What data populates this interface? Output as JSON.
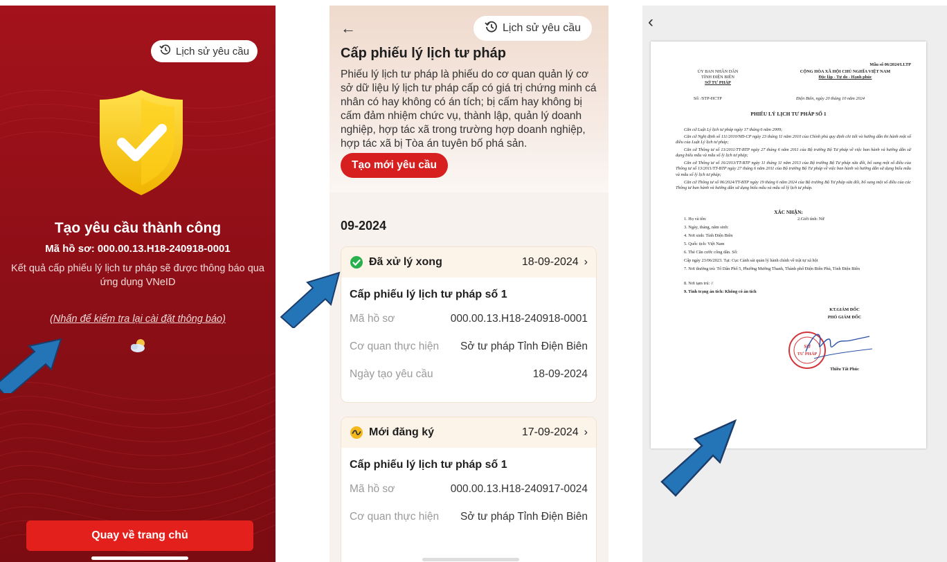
{
  "panel1": {
    "history_label": "Lịch sử yêu cầu",
    "title": "Tạo yêu cầu thành công",
    "code": "Mã hồ sơ: 000.00.13.H18-240918-0001",
    "description": "Kết quả cấp phiếu lý lịch tư pháp sẽ được thông báo qua ứng dụng VNeID",
    "settings_link": "(Nhấn để kiểm tra lại cài đặt thông báo)",
    "home_button": "Quay về trang chủ",
    "colors": {
      "background": "#9b111a",
      "button": "#e3201c",
      "shield": "#f5c81c"
    }
  },
  "panel2": {
    "back_icon": "arrow-left-icon",
    "history_label": "Lịch sử yêu cầu",
    "title": "Cấp phiếu lý lịch tư pháp",
    "description": "Phiếu lý lịch tư pháp là phiếu do cơ quan quản lý cơ sở dữ liệu lý lịch tư pháp cấp có giá trị chứng minh cá nhân có hay không có án tích; bị cấm hay không bị cấm đảm nhiệm chức vụ, thành lập, quản lý doanh nghiệp, hợp tác xã trong trường hợp doanh nghiệp, hợp tác xã bị Tòa án tuyên bố phá sản.",
    "new_request_button": "Tạo mới yêu cầu",
    "month": "09-2024",
    "requests": [
      {
        "status": "Đã xử lý xong",
        "status_icon": "check-circle-icon",
        "date": "18-09-2024",
        "title": "Cấp phiếu lý lịch tư pháp số 1",
        "fields": [
          {
            "label": "Mã hồ sơ",
            "value": "000.00.13.H18-240918-0001"
          },
          {
            "label": "Cơ quan thực hiện",
            "value": "Sở tư pháp Tỉnh Điện Biên"
          },
          {
            "label": "Ngày tạo yêu cầu",
            "value": "18-09-2024"
          }
        ]
      },
      {
        "status": "Mới đăng ký",
        "status_icon": "pending-wave-icon",
        "date": "17-09-2024",
        "title": "Cấp phiếu lý lịch tư pháp số 1",
        "fields": [
          {
            "label": "Mã hồ sơ",
            "value": "000.00.13.H18-240917-0024"
          },
          {
            "label": "Cơ quan thực hiện",
            "value": "Sở tư pháp Tỉnh Điện Biên"
          }
        ]
      }
    ]
  },
  "panel3": {
    "back_icon": "chevron-left-icon",
    "document": {
      "form_no": "Mẫu số 06/2024/LLTP",
      "issuer_line1": "ỦY BAN NHÂN DÂN",
      "issuer_line2": "TỈNH ĐIỆN BIÊN",
      "issuer_line3": "SỞ TƯ PHÁP",
      "nation": "CỘNG HÒA XÃ HỘI CHỦ NGHĨA VIỆT NAM",
      "motto": "Độc lập - Tự do - Hạnh phúc",
      "number": "Số: /STP-HCTP",
      "place_date": "Điện Biên, ngày 20 tháng 10 năm 2024",
      "title": "PHIẾU LÝ LỊCH TƯ PHÁP SỐ 1",
      "bases": [
        "Căn cứ Luật Lý lịch tư pháp ngày 17 tháng 6 năm 2009;",
        "Căn cứ Nghị định số 111/2010/NĐ-CP ngày 23 tháng 11 năm 2010 của Chính phủ quy định chi tiết và hướng dẫn thi hành một số điều của Luật Lý lịch tư pháp;",
        "Căn cứ Thông tư số 13/2011/TT-BTP ngày 27 tháng 6 năm 2011 của Bộ trưởng Bộ Tư pháp về việc ban hành và hướng dẫn sử dụng biểu mẫu và mẫu sổ lý lịch tư pháp;",
        "Căn cứ Thông tư số 16/2013/TT-BTP ngày 11 tháng 11 năm 2013 của Bộ trưởng Bộ Tư pháp sửa đổi, bổ sung một số điều của Thông tư số 13/2011/TT-BTP ngày 27 tháng 6 năm 2011 của Bộ trưởng Bộ Tư pháp về việc ban hành và hướng dẫn sử dụng biểu mẫu và mẫu sổ lý lịch tư pháp;",
        "Căn cứ Thông tư số 06/2024/TT-BTP ngày 19 tháng 6 năm 2024 của Bộ trưởng Bộ Tư pháp sửa đổi, bổ sung một số điều của các Thông tư ban hành và hướng dẫn sử dụng biểu mẫu và mẫu số lý lịch tư pháp."
      ],
      "confirm_title": "XÁC NHẬN:",
      "item1": "1. Họ và tên:",
      "item2": "2.Giới tính: Nữ",
      "item3": "3. Ngày, tháng, năm sinh:",
      "item4": "4. Nơi sinh: Tỉnh Điện Biên",
      "item5": "5. Quốc tịch: Việt Nam",
      "item6": "6. Thẻ Căn cước công dân. Số:",
      "item6b": "Cấp ngày 23/06/2023. Tại: Cục Cảnh sát quản lý hành chính về trật tự xã hội",
      "item7": "7. Nơi thường trú: Tổ Dân Phố 5, Phường Mường Thanh, Thành phố Điện Biên Phủ, Tỉnh Điện Biên",
      "item8": "8. Nơi tạm trú: //",
      "item9": "9. Tình trạng án tích: Không có án tích",
      "sign_role1": "KT.GIÁM ĐỐC",
      "sign_role2": "PHÓ GIÁM ĐỐC",
      "stamp_text": "SỞ TƯ PHÁP",
      "signer": "Thiều Tất Phúc"
    }
  }
}
